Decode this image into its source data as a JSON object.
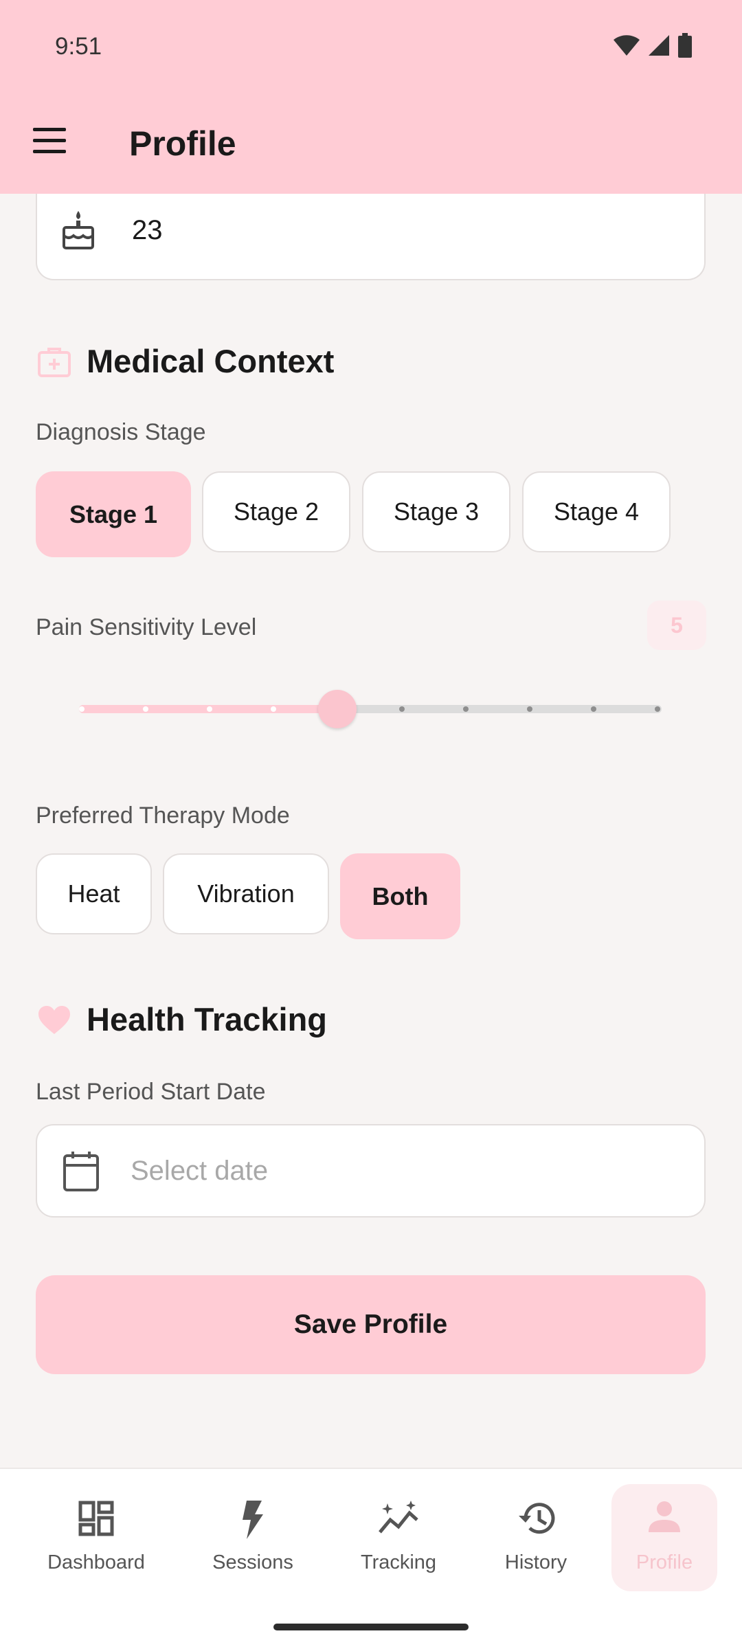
{
  "status_bar": {
    "time": "9:51"
  },
  "app_bar": {
    "title": "Profile"
  },
  "age_field": {
    "value": "23"
  },
  "medical_context": {
    "title": "Medical Context",
    "diagnosis_label": "Diagnosis Stage",
    "stages": [
      "Stage 1",
      "Stage 2",
      "Stage 3",
      "Stage 4"
    ],
    "selected_stage": "Stage 1",
    "pain_label": "Pain Sensitivity Level",
    "pain_value": "5",
    "pain_min": 1,
    "pain_max": 10,
    "therapy_label": "Preferred Therapy Mode",
    "therapy_modes": [
      "Heat",
      "Vibration",
      "Both"
    ],
    "selected_therapy": "Both"
  },
  "health_tracking": {
    "title": "Health Tracking",
    "period_label": "Last Period Start Date",
    "date_placeholder": "Select date"
  },
  "save_button": {
    "label": "Save Profile"
  },
  "bottom_nav": {
    "items": [
      {
        "label": "Dashboard",
        "icon": "dashboard-icon"
      },
      {
        "label": "Sessions",
        "icon": "bolt-icon"
      },
      {
        "label": "Tracking",
        "icon": "tracking-icon"
      },
      {
        "label": "History",
        "icon": "history-icon"
      },
      {
        "label": "Profile",
        "icon": "person-icon"
      }
    ],
    "active": "Profile"
  },
  "colors": {
    "primary": "#FFCCD5",
    "background": "#F7F4F3",
    "surface": "#FFFFFF",
    "accent_text": "#F6C4CC"
  }
}
